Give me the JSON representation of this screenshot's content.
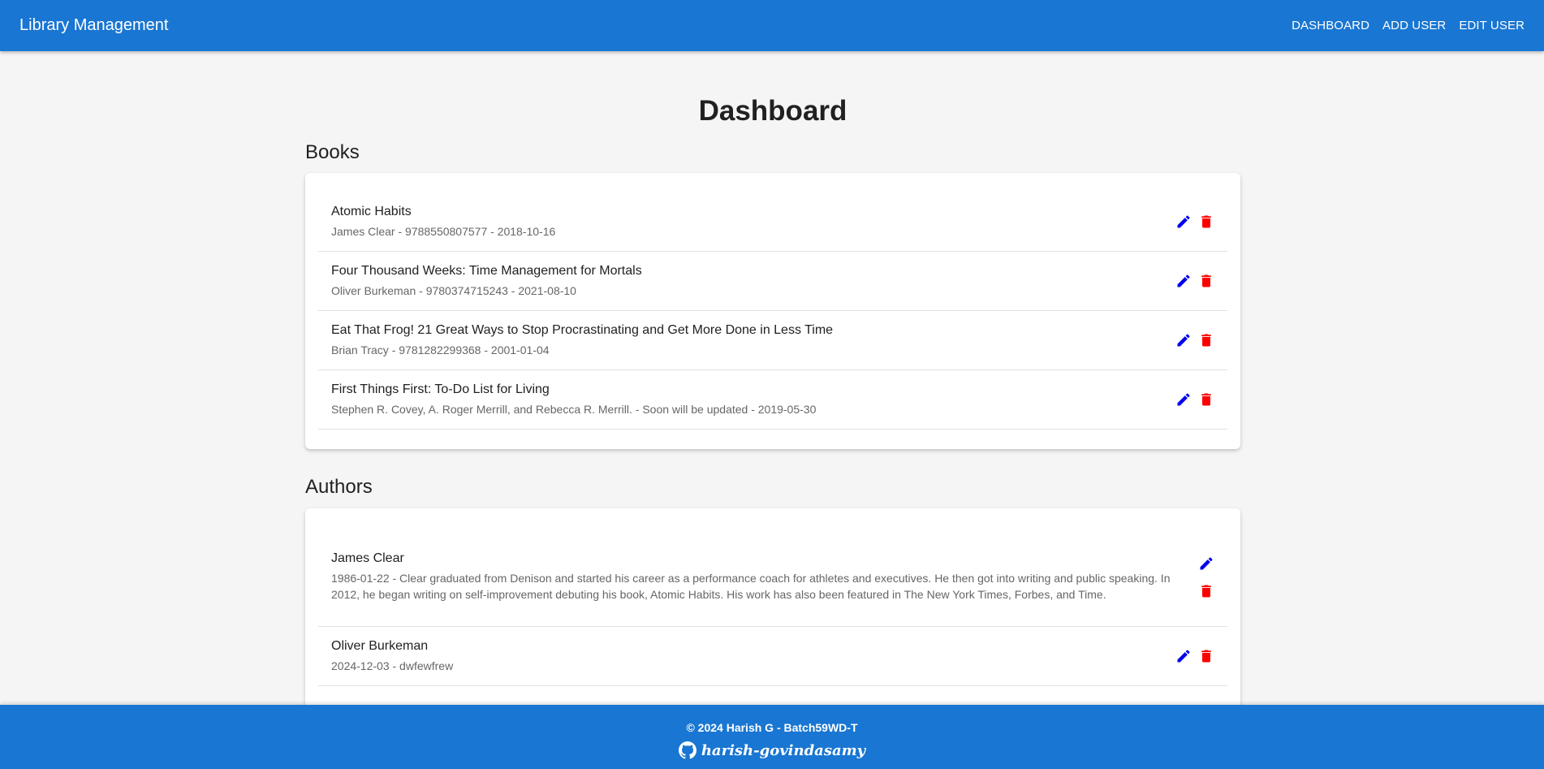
{
  "appbar": {
    "brand": "Library Management",
    "nav": [
      "DASHBOARD",
      "ADD USER",
      "EDIT USER"
    ]
  },
  "page": {
    "title": "Dashboard",
    "books_heading": "Books",
    "authors_heading": "Authors"
  },
  "books": [
    {
      "title": "Atomic Habits",
      "subtitle": "James Clear - 9788550807577 - 2018-10-16"
    },
    {
      "title": "Four Thousand Weeks: Time Management for Mortals",
      "subtitle": "Oliver Burkeman - 9780374715243 - 2021-08-10"
    },
    {
      "title": "Eat That Frog! 21 Great Ways to Stop Procrastinating and Get More Done in Less Time",
      "subtitle": "Brian Tracy - 9781282299368 - 2001-01-04"
    },
    {
      "title": "First Things First: To-Do List for Living",
      "subtitle": "Stephen R. Covey, A. Roger Merrill, and Rebecca R. Merrill. - Soon will be updated - 2019-05-30"
    }
  ],
  "authors": [
    {
      "name": "James Clear",
      "subtitle": "1986-01-22 - Clear graduated from Denison and started his career as a performance coach for athletes and executives. He then got into writing and public speaking. In 2012, he began writing on self-improvement debuting his book, Atomic Habits. His work has also been featured in The New York Times, Forbes, and Time."
    },
    {
      "name": "Oliver Burkeman",
      "subtitle": "2024-12-03 - dwfewfrew"
    }
  ],
  "icons": {
    "edit": "pencil-icon",
    "delete": "trash-icon",
    "github": "github-icon"
  },
  "colors": {
    "primary": "#1976d2",
    "edit": "#0000ee",
    "delete": "#ff0000"
  },
  "footer": {
    "copyright": "© 2024 Harish G - Batch59WD-T",
    "github_handle": "harish-govindasamy"
  }
}
